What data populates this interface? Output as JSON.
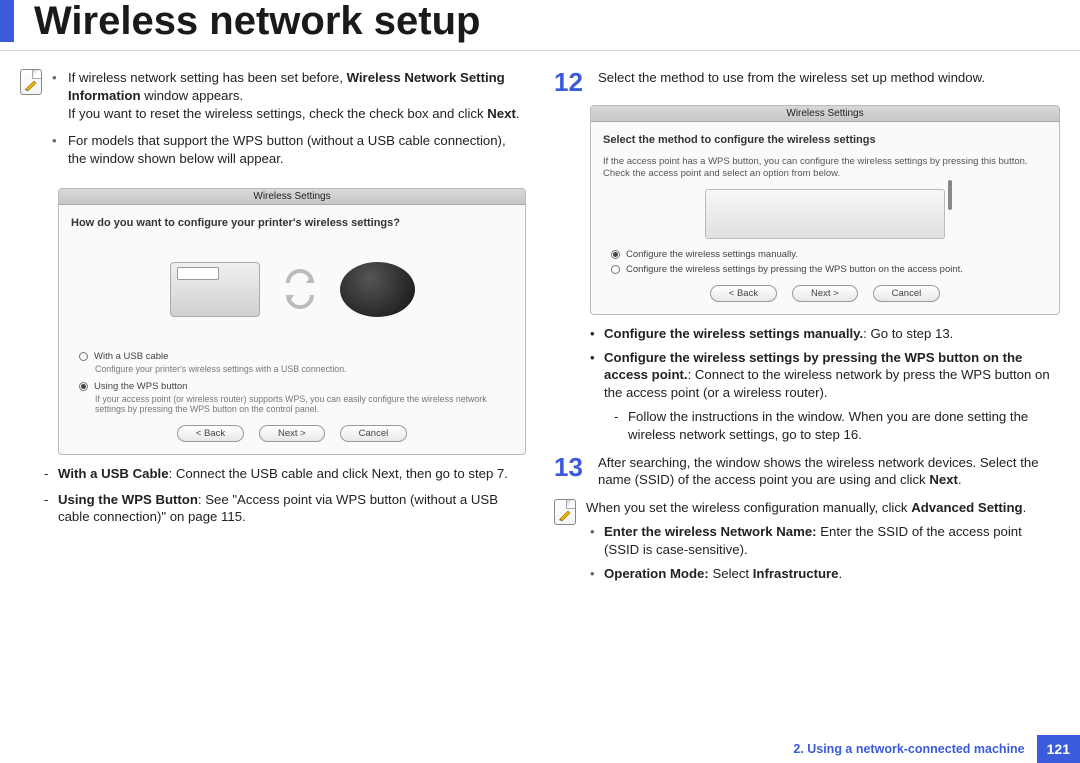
{
  "header": {
    "title": "Wireless network setup"
  },
  "left": {
    "noteA": {
      "b1a": "If wireless network setting has been set before, ",
      "b1b": "Wireless Network Setting Information",
      "b1c": " window appears.",
      "b1d": "If you want to reset the wireless settings, check the check box and click ",
      "b1e": "Next",
      "b1f": ".",
      "b2": "For models that support the WPS button (without a USB cable connection), the window shown below will appear."
    },
    "fig1": {
      "bar": "Wireless Settings",
      "h": "How do you want to configure your printer's wireless settings?",
      "opt1": "With a USB cable",
      "opt1d": "Configure your printer's wireless settings with a USB connection.",
      "opt2": "Using the WPS button",
      "opt2d": "If your access point (or wireless router) supports WPS, you can easily configure the wireless network settings by pressing the WPS button on the control panel.",
      "back": "< Back",
      "next": "Next >",
      "cancel": "Cancel"
    },
    "tail": {
      "t1a": "With a USB Cable",
      "t1b": ": Connect the USB cable and click Next, then go to step 7.",
      "t2a": "Using the WPS Button",
      "t2b": ": See \"Access point via WPS button (without a USB cable connection)\" on page 115."
    }
  },
  "right": {
    "s12": {
      "num": "12",
      "text": "Select the method to use from the wireless set up method window."
    },
    "fig2": {
      "bar": "Wireless Settings",
      "h": "Select the method to configure the wireless settings",
      "sub": "If the access point has a WPS button, you can configure the wireless settings by pressing this button.\nCheck the access point and select an option from below.",
      "opt1": "Configure the wireless settings manually.",
      "opt2": "Configure the wireless settings by pressing the WPS button on the access point.",
      "back": "< Back",
      "next": "Next >",
      "cancel": "Cancel"
    },
    "opts": {
      "o1a": "Configure the wireless settings manually.",
      "o1b": ": Go to step 13.",
      "o2a": "Configure the wireless settings by pressing the WPS button on the access point.",
      "o2b": ": Connect to the wireless network by press the WPS button on the access point (or a wireless router).",
      "o3": "Follow the instructions in the window. When you are done setting the wireless network settings, go to step 16."
    },
    "s13": {
      "num": "13",
      "t1": "After searching, the window shows the wireless network devices. Select the name (SSID) of the access point you are using and click ",
      "t2": "Next",
      "t3": "."
    },
    "note": {
      "t1": "When you set the wireless configuration manually, click ",
      "t2": "Advanced Setting",
      "t3": ".",
      "b1a": "Enter the wireless Network Name:",
      "b1b": " Enter the SSID of the access point (SSID is case-sensitive).",
      "b2a": "Operation Mode:",
      "b2b": " Select ",
      "b2c": "Infrastructure",
      "b2d": "."
    }
  },
  "footer": {
    "chapter": "2.  Using a network-connected machine",
    "page": "121"
  }
}
